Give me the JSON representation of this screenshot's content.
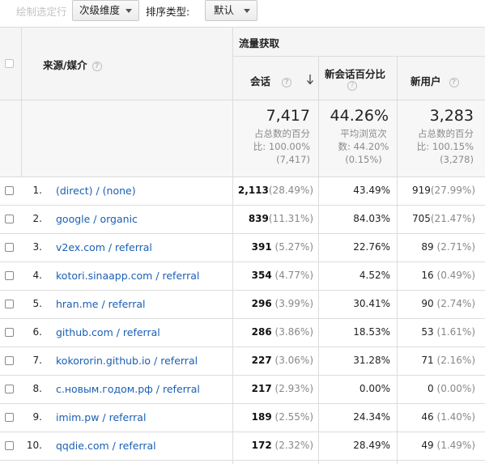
{
  "toolbar": {
    "plot_rows_label": "绘制选定行",
    "secondary_dimension_label": "次级维度",
    "sort_type_label": "排序类型:",
    "sort_type_value": "默认"
  },
  "table": {
    "group_header": "流量获取",
    "dimension_header": "来源/媒介",
    "columns": {
      "sessions": "会话",
      "new_session_pct": "新会话百分比",
      "new_users": "新用户"
    },
    "summary": {
      "sessions": {
        "value": "7,417",
        "line1": "占总数的百分",
        "line2": "比: 100.00%",
        "line3": "(7,417)"
      },
      "new_session_pct": {
        "value": "44.26%",
        "line1": "平均浏览次",
        "line2": "数: 44.20%",
        "line3": "(0.15%)"
      },
      "new_users": {
        "value": "3,283",
        "line1": "占总数的百分",
        "line2": "比: 100.15%",
        "line3": "(3,278)"
      }
    },
    "rows": [
      {
        "index": "1.",
        "source": "(direct) / (none)",
        "sessions": "2,113",
        "sessions_pct": "(28.49%)",
        "new_pct": "43.49%",
        "new_users": "919",
        "new_users_pct": "(27.99%)"
      },
      {
        "index": "2.",
        "source": "google / organic",
        "sessions": "839",
        "sessions_pct": "(11.31%)",
        "new_pct": "84.03%",
        "new_users": "705",
        "new_users_pct": "(21.47%)"
      },
      {
        "index": "3.",
        "source": "v2ex.com / referral",
        "sessions": "391",
        "sessions_pct": "(5.27%)",
        "new_pct": "22.76%",
        "new_users": "89",
        "new_users_pct": "(2.71%)"
      },
      {
        "index": "4.",
        "source": "kotori.sinaapp.com / referral",
        "sessions": "354",
        "sessions_pct": "(4.77%)",
        "new_pct": "4.52%",
        "new_users": "16",
        "new_users_pct": "(0.49%)"
      },
      {
        "index": "5.",
        "source": "hran.me / referral",
        "sessions": "296",
        "sessions_pct": "(3.99%)",
        "new_pct": "30.41%",
        "new_users": "90",
        "new_users_pct": "(2.74%)"
      },
      {
        "index": "6.",
        "source": "github.com / referral",
        "sessions": "286",
        "sessions_pct": "(3.86%)",
        "new_pct": "18.53%",
        "new_users": "53",
        "new_users_pct": "(1.61%)"
      },
      {
        "index": "7.",
        "source": "kokororin.github.io / referral",
        "sessions": "227",
        "sessions_pct": "(3.06%)",
        "new_pct": "31.28%",
        "new_users": "71",
        "new_users_pct": "(2.16%)"
      },
      {
        "index": "8.",
        "source": "с.новым.годом.рф / referral",
        "sessions": "217",
        "sessions_pct": "(2.93%)",
        "new_pct": "0.00%",
        "new_users": "0",
        "new_users_pct": "(0.00%)"
      },
      {
        "index": "9.",
        "source": "imim.pw / referral",
        "sessions": "189",
        "sessions_pct": "(2.55%)",
        "new_pct": "24.34%",
        "new_users": "46",
        "new_users_pct": "(1.40%)"
      },
      {
        "index": "10.",
        "source": "qqdie.com / referral",
        "sessions": "172",
        "sessions_pct": "(2.32%)",
        "new_pct": "28.49%",
        "new_users": "49",
        "new_users_pct": "(1.49%)"
      }
    ]
  },
  "colors": {
    "link": "#1a5fb4",
    "border": "#dcdcdc",
    "muted": "#888888",
    "header_bg": "#f5f5f5",
    "summary_bg": "#f7f7f7"
  },
  "icons": {
    "help": "question-circle-icon",
    "sort": "arrow-down-icon",
    "dropdown": "caret-down-icon"
  }
}
